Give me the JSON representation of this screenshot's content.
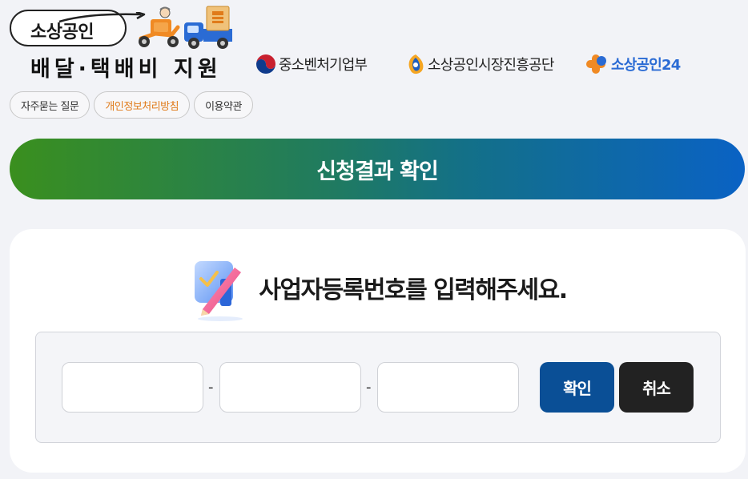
{
  "logo": {
    "title": "소상공인",
    "subtitle": "배달·택배비 지원"
  },
  "agencies": {
    "mss": "중소벤처기업부",
    "semas": "소상공인시장진흥공단",
    "sb24": "소상공인24"
  },
  "quick_links": {
    "faq": "자주묻는 질문",
    "privacy": "개인정보처리방침",
    "terms": "이용약관"
  },
  "banner": {
    "title": "신청결과 확인"
  },
  "card": {
    "title": "사업자등록번호를 입력해주세요."
  },
  "form": {
    "separator": "-",
    "part1_value": "",
    "part2_value": "",
    "part3_value": "",
    "confirm_label": "확인",
    "cancel_label": "취소"
  },
  "colors": {
    "background": "#f2f3f7",
    "banner_start": "#3a8f1e",
    "banner_end": "#0a62c4",
    "confirm_button": "#0a4f96",
    "cancel_button": "#222222",
    "privacy_link": "#e07b1a",
    "sb24_brand": "#2a6bd4"
  }
}
